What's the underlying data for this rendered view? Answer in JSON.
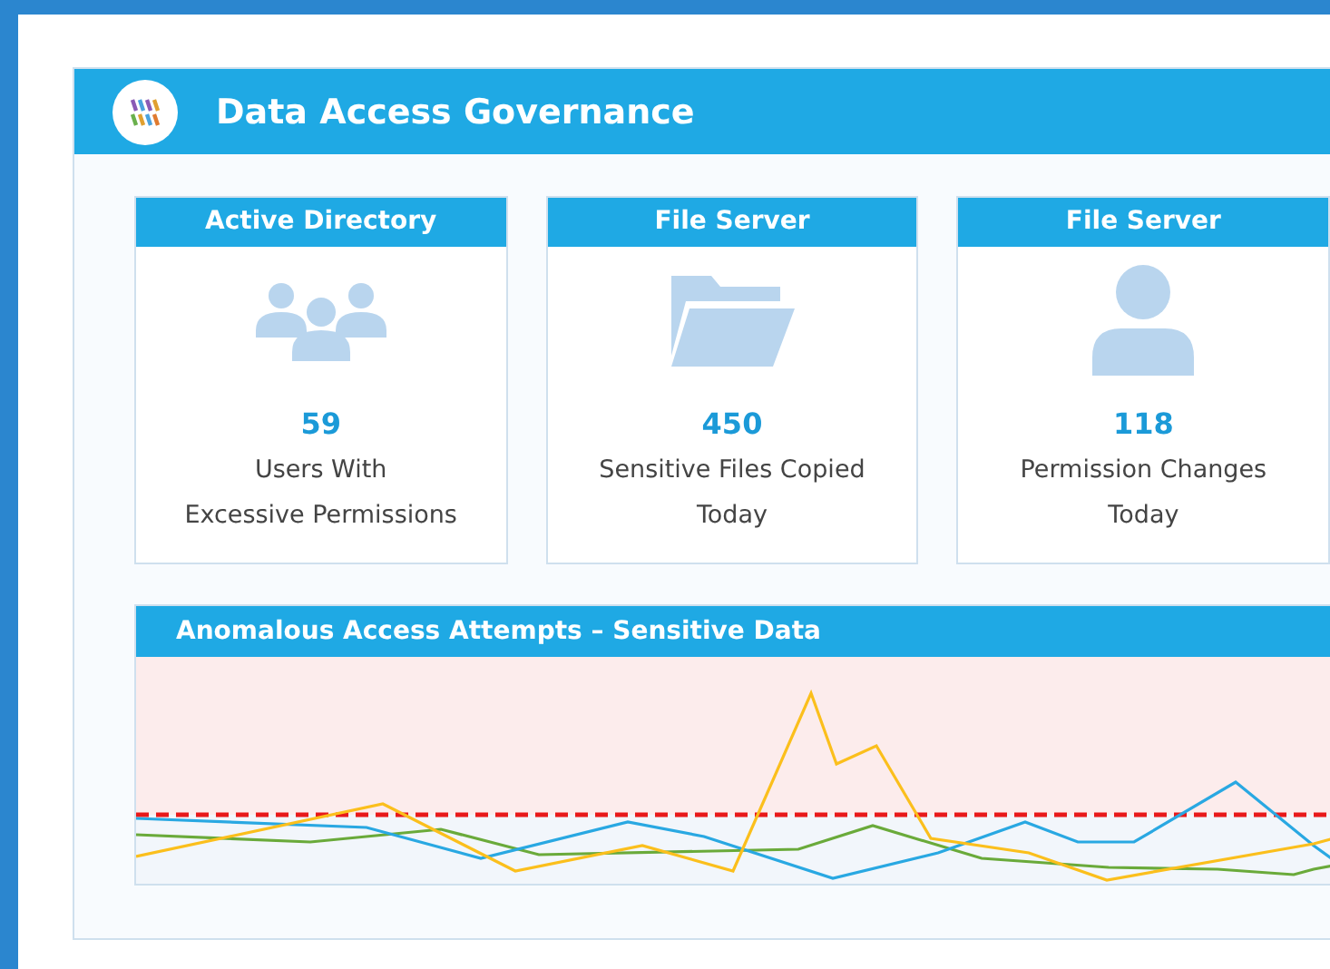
{
  "header": {
    "title": "Data Access Governance"
  },
  "cards": [
    {
      "source": "Active Directory",
      "kind": "users",
      "value": "59",
      "label": "Users With\nExcessive Permissions"
    },
    {
      "source": "File Server",
      "kind": "folder",
      "value": "450",
      "label": "Sensitive Files Copied\nToday"
    },
    {
      "source": "File Server",
      "kind": "user",
      "value": "118",
      "label": "Permission Changes\nToday"
    }
  ],
  "chart_panel": {
    "title": "Anomalous Access Attempts – Sensitive Data"
  }
}
